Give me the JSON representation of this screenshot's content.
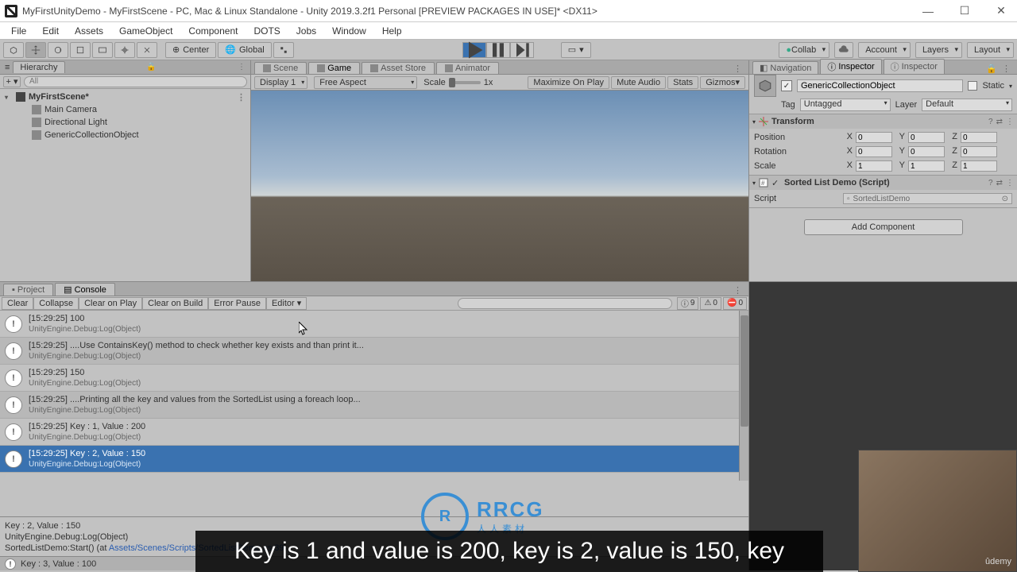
{
  "titlebar": {
    "title": "MyFirstUnityDemo - MyFirstScene - PC, Mac & Linux Standalone - Unity 2019.3.2f1 Personal [PREVIEW PACKAGES IN USE]* <DX11>"
  },
  "menubar": [
    "File",
    "Edit",
    "Assets",
    "GameObject",
    "Component",
    "DOTS",
    "Jobs",
    "Window",
    "Help"
  ],
  "toolbar": {
    "pivot": "Center",
    "handle": "Global",
    "collab": "Collab",
    "account": "Account",
    "layers": "Layers",
    "layout": "Layout"
  },
  "hierarchy": {
    "tab": "Hierarchy",
    "search_placeholder": "All",
    "scene": "MyFirstScene*",
    "items": [
      "Main Camera",
      "Directional Light",
      "GenericCollectionObject"
    ]
  },
  "sceneview": {
    "tabs": [
      "Scene",
      "Game",
      "Asset Store",
      "Animator"
    ],
    "active_tab": 1,
    "display": "Display 1",
    "aspect": "Free Aspect",
    "scale_label": "Scale",
    "scale_value": "1x",
    "maximize": "Maximize On Play",
    "mute": "Mute Audio",
    "stats": "Stats",
    "gizmos": "Gizmos"
  },
  "inspector": {
    "tabs": [
      "Navigation",
      "Inspector",
      "Inspector"
    ],
    "active_tab": 1,
    "object_name": "GenericCollectionObject",
    "static_label": "Static",
    "tag_label": "Tag",
    "tag_value": "Untagged",
    "layer_label": "Layer",
    "layer_value": "Default",
    "transform": {
      "title": "Transform",
      "position_label": "Position",
      "rotation_label": "Rotation",
      "scale_label": "Scale",
      "position": {
        "x": "0",
        "y": "0",
        "z": "0"
      },
      "rotation": {
        "x": "0",
        "y": "0",
        "z": "0"
      },
      "scale": {
        "x": "1",
        "y": "1",
        "z": "1"
      }
    },
    "script_comp": {
      "title": "Sorted List Demo (Script)",
      "script_label": "Script",
      "script_value": "SortedListDemo"
    },
    "add_component": "Add Component"
  },
  "console": {
    "project_tab": "Project",
    "console_tab": "Console",
    "buttons": [
      "Clear",
      "Collapse",
      "Clear on Play",
      "Clear on Build",
      "Error Pause",
      "Editor ▾"
    ],
    "counts": {
      "info": "9",
      "warn": "0",
      "error": "0"
    },
    "trace": "UnityEngine.Debug:Log(Object)",
    "items": [
      {
        "msg": "[15:29:25] 100"
      },
      {
        "msg": "[15:29:25] ....Use ContainsKey() method to check whether key exists and than print it..."
      },
      {
        "msg": "[15:29:25] 150"
      },
      {
        "msg": "[15:29:25] ....Printing all the key and values from the SortedList using a foreach loop..."
      },
      {
        "msg": "[15:29:25] Key : 1, Value : 200"
      },
      {
        "msg": "[15:29:25] Key : 2, Value : 150"
      }
    ],
    "selected": 5,
    "detail": {
      "line1": "Key : 2, Value : 150",
      "line2": "UnityEngine.Debug:Log(Object)",
      "line3_prefix": "SortedListDemo:Start() (at ",
      "line3_link": "Assets/Scenes/Scripts/SortedListDemo.cs:39",
      "line3_suffix": ")"
    },
    "footer": "Key : 3, Value : 100"
  },
  "watermark": {
    "text": "RRCG",
    "sub": "人人素材"
  },
  "subtitle": "Key is 1 and value is 200, key is 2, value is 150, key",
  "webcam_logo": "ûdemy"
}
